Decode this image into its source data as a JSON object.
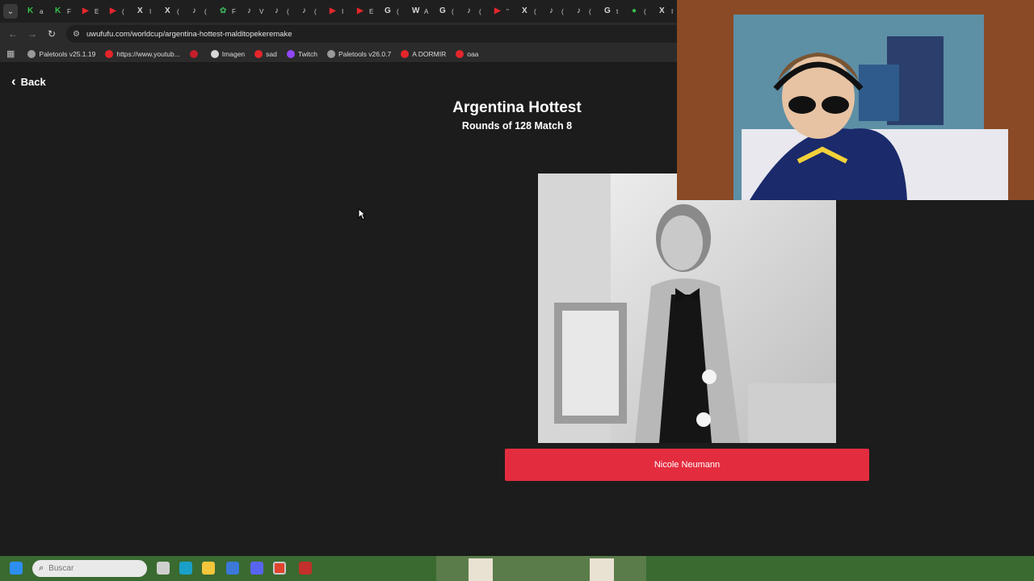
{
  "browser": {
    "tabs": [
      {
        "glyph": "K",
        "color": "#35c24a",
        "label": "a"
      },
      {
        "glyph": "K",
        "color": "#35c24a",
        "label": "F"
      },
      {
        "glyph": "▶",
        "color": "#e4262b",
        "label": "E"
      },
      {
        "glyph": "▶",
        "color": "#e4262b",
        "label": "("
      },
      {
        "glyph": "X",
        "color": "#d8d8d8",
        "label": "I"
      },
      {
        "glyph": "X",
        "color": "#d8d8d8",
        "label": "("
      },
      {
        "glyph": "♪",
        "color": "#d8d8d8",
        "label": "("
      },
      {
        "glyph": "✿",
        "color": "#3aa858",
        "label": "F"
      },
      {
        "glyph": "♪",
        "color": "#d8d8d8",
        "label": "V"
      },
      {
        "glyph": "♪",
        "color": "#d8d8d8",
        "label": "("
      },
      {
        "glyph": "♪",
        "color": "#d8d8d8",
        "label": "("
      },
      {
        "glyph": "▶",
        "color": "#e4262b",
        "label": "I"
      },
      {
        "glyph": "▶",
        "color": "#e4262b",
        "label": "E"
      },
      {
        "glyph": "G",
        "color": "#d8d8d8",
        "label": "("
      },
      {
        "glyph": "W",
        "color": "#d8d8d8",
        "label": "A"
      },
      {
        "glyph": "G",
        "color": "#d8d8d8",
        "label": "("
      },
      {
        "glyph": "♪",
        "color": "#d8d8d8",
        "label": "("
      },
      {
        "glyph": "▶",
        "color": "#e4262b",
        "label": "\""
      },
      {
        "glyph": "X",
        "color": "#d8d8d8",
        "label": "("
      },
      {
        "glyph": "♪",
        "color": "#d8d8d8",
        "label": "("
      },
      {
        "glyph": "♪",
        "color": "#d8d8d8",
        "label": "("
      },
      {
        "glyph": "G",
        "color": "#d8d8d8",
        "label": "t"
      },
      {
        "glyph": "●",
        "color": "#35c24a",
        "label": "("
      },
      {
        "glyph": "X",
        "color": "#d8d8d8",
        "label": "I"
      }
    ],
    "url": "uwufufu.com/worldcup/argentina-hottest-malditopekeremake",
    "bookmarks": [
      {
        "label": "Paletools v25.1.19",
        "color": "#9a9a9a"
      },
      {
        "label": "https://www.youtub...",
        "color": "#e4262b"
      },
      {
        "label": "",
        "color": "#c21f2b"
      },
      {
        "label": "Imagen",
        "color": "#d8d8d8"
      },
      {
        "label": "sad",
        "color": "#e4262b"
      },
      {
        "label": "Twitch",
        "color": "#9146ff"
      },
      {
        "label": "Paletools v26.0.7",
        "color": "#9a9a9a"
      },
      {
        "label": "A DORMIR",
        "color": "#e4262b"
      },
      {
        "label": "oaa",
        "color": "#e4262b"
      }
    ]
  },
  "page": {
    "back_label": "Back",
    "title": "Argentina Hottest",
    "subtitle": "Rounds of 128 Match 8",
    "candidate_name": "Nicole Neumann",
    "accent": "#e42c3f"
  },
  "taskbar": {
    "search_placeholder": "Buscar"
  }
}
